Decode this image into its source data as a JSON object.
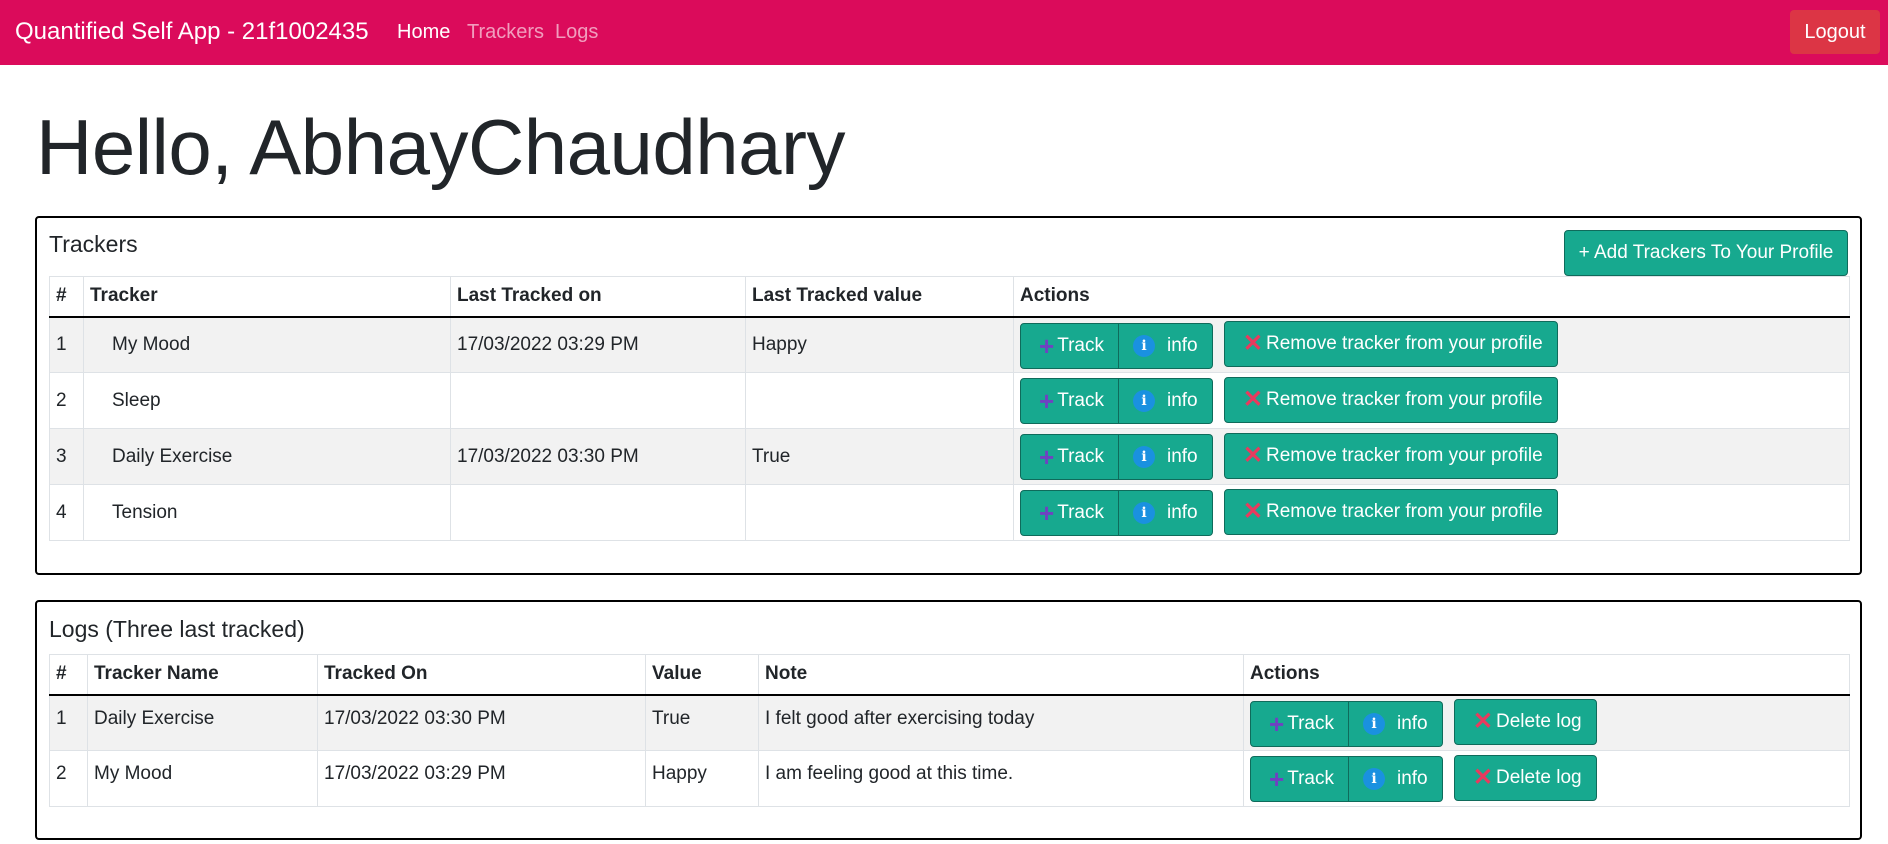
{
  "navbar": {
    "brand": "Quantified Self App - 21f1002435",
    "links": [
      "Home",
      "Trackers",
      "Logs"
    ],
    "logout_label": "Logout"
  },
  "greeting": "Hello, AbhayChaudhary",
  "trackers_card": {
    "title": "Trackers",
    "add_button_label": "+ Add Trackers To Your Profile",
    "headers": [
      "#",
      "Tracker",
      "Last Tracked on",
      "Last Tracked value",
      "Actions"
    ],
    "rows": [
      {
        "num": "1",
        "tracker": "My Mood",
        "last_on": "17/03/2022 03:29 PM",
        "last_value": "Happy"
      },
      {
        "num": "2",
        "tracker": "Sleep",
        "last_on": "",
        "last_value": ""
      },
      {
        "num": "3",
        "tracker": "Daily Exercise",
        "last_on": "17/03/2022 03:30 PM",
        "last_value": "True"
      },
      {
        "num": "4",
        "tracker": "Tension",
        "last_on": "",
        "last_value": ""
      }
    ],
    "actions": {
      "track": "Track",
      "info": "info",
      "remove": "Remove tracker from your profile"
    }
  },
  "logs_card": {
    "title": "Logs (Three last tracked)",
    "headers": [
      "#",
      "Tracker Name",
      "Tracked On",
      "Value",
      "Note",
      "Actions"
    ],
    "rows": [
      {
        "num": "1",
        "tracker": "Daily Exercise",
        "tracked_on": "17/03/2022 03:30 PM",
        "value": "True",
        "note": "I felt good after exercising today"
      },
      {
        "num": "2",
        "tracker": "My Mood",
        "tracked_on": "17/03/2022 03:29 PM",
        "value": "Happy",
        "note": "I am feeling good at this time."
      }
    ],
    "actions": {
      "track": "Track",
      "info": "info",
      "delete": "Delete log"
    }
  },
  "icons": {
    "track": "plus-icon",
    "info": "info-circle-icon",
    "remove": "x-icon"
  },
  "colors": {
    "navbar": "#db0b5b",
    "logout": "#dc3545",
    "button": "#17a98f",
    "plus": "#6f42c1",
    "info": "#1a91e0",
    "x": "#e83a5e"
  }
}
